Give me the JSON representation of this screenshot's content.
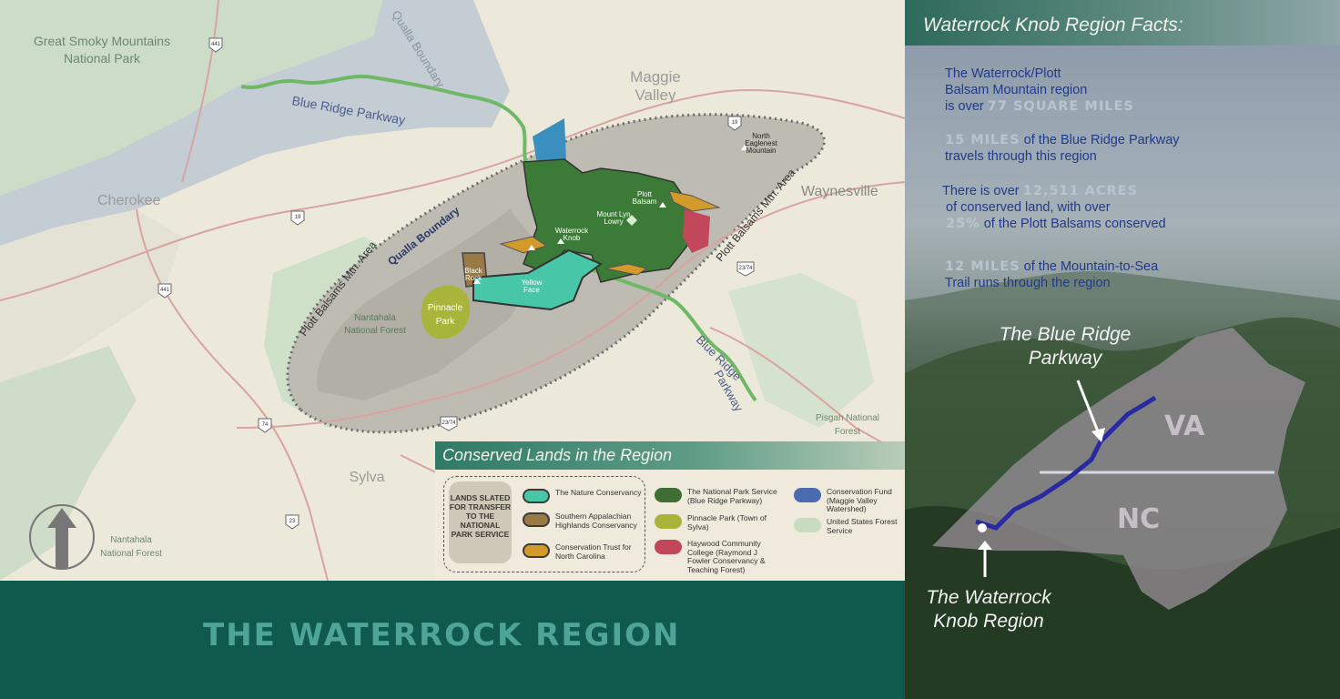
{
  "map": {
    "labels": {
      "great_smoky_1": "Great Smoky Mountains",
      "great_smoky_2": "National Park",
      "qualla_top": "Qualla Boundary",
      "qualla_mid": "Qualla Boundary",
      "maggie_1": "Maggie",
      "maggie_2": "Valley",
      "brp_top": "Blue Ridge Parkway",
      "brp_right_1": "Blue Ridge",
      "brp_right_2": "Parkway",
      "cherokee": "Cherokee",
      "waynesville": "Waynesville",
      "plott_area_left": "Plott Balsams Mtn. Area",
      "plott_area_right": "Plott Balsams Mtn. Area",
      "north_eaglenest_1": "North",
      "north_eaglenest_2": "Eaglenest",
      "north_eaglenest_3": "Mountain",
      "plott_balsam_1": "Plott",
      "plott_balsam_2": "Balsam",
      "mount_lyn_1": "Mount Lyn",
      "mount_lyn_2": "Lowry",
      "waterrock_1": "Waterrock",
      "waterrock_2": "Knob",
      "black_rock_1": "Black",
      "black_rock_2": "Rock",
      "yellow_face_1": "Yellow",
      "yellow_face_2": "Face",
      "pinnacle_1": "Pinnacle",
      "pinnacle_2": "Park",
      "nantahala_nf_1": "Nantahala",
      "nantahala_nf_2": "National Forest",
      "nantahala_nf_b1": "Nantahala",
      "nantahala_nf_b2": "National Forest",
      "pisgah_1": "Pisgah National",
      "pisgah_2": "Forest",
      "sylva": "Sylva"
    },
    "shields": {
      "s441_top": "441",
      "s19_top": "19",
      "s19_cherokee": "19",
      "s441_left": "441",
      "s23_74_right": "23/74",
      "s74": "74",
      "s23_74_bottom": "23/74",
      "s23": "23"
    }
  },
  "legend": {
    "title": "Conserved Lands in the Region",
    "transfer_label": "LANDS SLATED FOR TRANSFER TO THE NATIONAL PARK SERVICE",
    "items": [
      {
        "label": "The Nature Conservancy",
        "color": "#47c7a8",
        "outline": "#3a3a3a"
      },
      {
        "label": "Southern Appalachian Highlands Conservancy",
        "color": "#9a7a44",
        "outline": "#3a3a3a"
      },
      {
        "label": "Conservation Trust for North Carolina",
        "color": "#d29a2b",
        "outline": "#3a3a3a"
      },
      {
        "label": "The National Park Service (Blue Ridge Parkway)",
        "color": "#3e6e34",
        "outline": ""
      },
      {
        "label": "Pinnacle Park (Town of Sylva)",
        "color": "#a9b43a",
        "outline": ""
      },
      {
        "label": "Haywood Community College (Raymond J Fowler Conservancy & Teaching Forest)",
        "color": "#c2475b",
        "outline": ""
      },
      {
        "label": "Conservation Fund (Maggie Valley Watershed)",
        "color": "#4a6bb0",
        "outline": ""
      },
      {
        "label": "United States Forest Service",
        "color": "#c8dcc0",
        "outline": ""
      }
    ]
  },
  "banner": {
    "title": "THE WATERROCK REGION"
  },
  "facts_panel": {
    "title": "Waterrock Knob Region Facts:",
    "fact1": {
      "a": "The Waterrock/Plott",
      "b": "Balsam Mountain region",
      "c_pre": "is over ",
      "c_hl": "77 SQUARE MILES"
    },
    "fact2": {
      "hl": "15 MILES",
      "a_post": " of the Blue Ridge Parkway",
      "b": "travels through this region"
    },
    "fact3": {
      "a_pre": "There is over ",
      "a_hl": "12,511 ACRES",
      "b": "of conserved land, with over",
      "c_hl": "25%",
      "c_post": " of the Plott Balsams conserved"
    },
    "fact4": {
      "hl": "12 MILES",
      "a_post": " of the Mountain-to-Sea",
      "b": "Trail runs through the region"
    },
    "inset": {
      "brp_1": "The Blue Ridge",
      "brp_2": "Parkway",
      "va": "VA",
      "nc": "NC",
      "wr_1": "The Waterrock",
      "wr_2": "Knob Region"
    }
  }
}
